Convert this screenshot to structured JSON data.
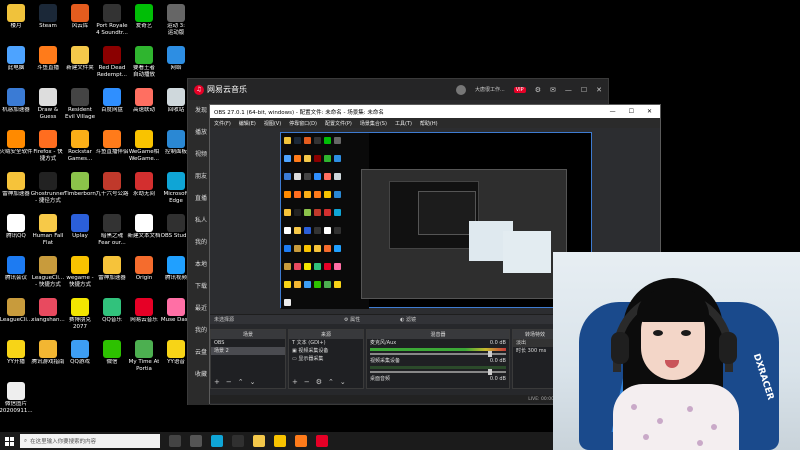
{
  "desktop_icons": [
    {
      "label": "楼月",
      "color": "#f0c23b"
    },
    {
      "label": "Steam",
      "color": "#1b2838"
    },
    {
      "label": "风云库",
      "color": "#e45c1e"
    },
    {
      "label": "Port Royale\n4 Soundtr...",
      "color": "#333"
    },
    {
      "label": "爱奇艺",
      "color": "#00be06"
    },
    {
      "label": "运动 3:\n运动版",
      "color": "#666"
    },
    {
      "label": "此电脑",
      "color": "#4da3ff"
    },
    {
      "label": "斗鱼直播",
      "color": "#ff7b1a"
    },
    {
      "label": "新建文件夹",
      "color": "#f4c84a"
    },
    {
      "label": "Red Dead\nRedempt...",
      "color": "#8b0000"
    },
    {
      "label": "要看王者\n自动播放",
      "color": "#2fb52f"
    },
    {
      "label": "网络",
      "color": "#2d8ee3"
    },
    {
      "label": "机惑加速器",
      "color": "#3a7bd5"
    },
    {
      "label": "Draw &\nGuess",
      "color": "#ddd"
    },
    {
      "label": "Resident\nEvil Village",
      "color": "#444"
    },
    {
      "label": "百度网盘",
      "color": "#2f8fff"
    },
    {
      "label": "高速联动",
      "color": "#ff6f61"
    },
    {
      "label": "回收站",
      "color": "#cfd8dc"
    },
    {
      "label": "火绒安全软件",
      "color": "#ff8a00"
    },
    {
      "label": "Firefox - 快\n捷方式",
      "color": "#ff6d1f"
    },
    {
      "label": "Rockstar\nGames...",
      "color": "#fcaf17"
    },
    {
      "label": "斗鱼直播伴侣",
      "color": "#ff7b1a"
    },
    {
      "label": "WeGame相\nWeGame...",
      "color": "#f9c300"
    },
    {
      "label": "控制面板",
      "color": "#2a88d4"
    },
    {
      "label": "雷神加速器",
      "color": "#f6c33a"
    },
    {
      "label": "Ghostrunner\n- 捷径方式",
      "color": "#222"
    },
    {
      "label": "Timberborn",
      "color": "#8bc34a"
    },
    {
      "label": "九十六号公路",
      "color": "#c0392b"
    },
    {
      "label": "永劫无间",
      "color": "#d32f2f"
    },
    {
      "label": "Microsoft\nEdge",
      "color": "#0fa5d6"
    },
    {
      "label": "腾讯QQ",
      "color": "#ffffff"
    },
    {
      "label": "Human Fall\nFlat",
      "color": "#f7c948"
    },
    {
      "label": "Uplay",
      "color": "#2b5fd9"
    },
    {
      "label": "暗黑之魂\nFear our...",
      "color": "#333"
    },
    {
      "label": "新建文本文档",
      "color": "#ffffff"
    },
    {
      "label": "OBS Studio",
      "color": "#303030"
    },
    {
      "label": "腾讯会议",
      "color": "#1d7bf2"
    },
    {
      "label": "LeagueCli...\n- 快捷方式",
      "color": "#c89b3c"
    },
    {
      "label": "wegame - \n快捷方式",
      "color": "#f9c300"
    },
    {
      "label": "雷神加速器",
      "color": "#f6c33a"
    },
    {
      "label": "Origin",
      "color": "#f56c2d"
    },
    {
      "label": "腾讯视频",
      "color": "#20a0ff"
    },
    {
      "label": "LeagueCli...",
      "color": "#c89b3c"
    },
    {
      "label": "xiangshan...",
      "color": "#e84a5f"
    },
    {
      "label": "赛博朋克\n2077",
      "color": "#f3e600"
    },
    {
      "label": "QQ音乐",
      "color": "#31c27c"
    },
    {
      "label": "网易云音乐",
      "color": "#e60026"
    },
    {
      "label": "Muse Dash",
      "color": "#ff6fa5"
    },
    {
      "label": "YY开播",
      "color": "#f7d417"
    },
    {
      "label": "腾讯游戏指南",
      "color": "#f2b632"
    },
    {
      "label": "QQ游戏",
      "color": "#3d9ef3"
    },
    {
      "label": "微信",
      "color": "#2dc100"
    },
    {
      "label": "My Time At\nPortia",
      "color": "#4caf50"
    },
    {
      "label": "YY语音",
      "color": "#f7d417"
    },
    {
      "label": "微信图片\n20200911...",
      "color": "#eeeeee"
    }
  ],
  "music": {
    "title": "网易云音乐",
    "user": "大唐很工作...",
    "vip": "VIP",
    "nav": [
      "发现",
      "播放",
      "视频",
      "朋友",
      "直播",
      "私人",
      "我的",
      "本地",
      "下载",
      "最近",
      "我的",
      "云盘",
      "收藏"
    ]
  },
  "obs": {
    "title": "OBS 27.0.1 (64-bit, windows) - 配置文件: 未命名 - 场景集: 未命名",
    "menu": [
      "文件(F)",
      "编辑(E)",
      "视图(V)",
      "停靠窗口(D)",
      "配置文件(P)",
      "场景集合(S)",
      "工具(T)",
      "帮助(H)"
    ],
    "dock_headers": [
      "场景",
      "来源",
      "混音器",
      "转场特效"
    ],
    "top_bar": "未选择源",
    "scene_items": [
      "OBS",
      "场景 2"
    ],
    "source_items": [
      "文本 (GDI+)",
      "视频采集设备",
      "显示器采集"
    ],
    "mixer_channels": [
      {
        "name": "麦克风/Aux",
        "db": "0.0 dB"
      },
      {
        "name": "视频采集设备",
        "db": "0.0 dB"
      },
      {
        "name": "桌面音频",
        "db": "0.0 dB"
      }
    ],
    "transition": "淡出",
    "duration_label": "时长",
    "duration_value": "300 ms",
    "status": [
      "LIVE: 00:00:00",
      "REC: 00:00:00",
      "CPU: 4.6%, 30.00 fps"
    ]
  },
  "webcam": {
    "chair_text": "DXRACER"
  },
  "taskbar": {
    "search_placeholder": "在这里输入你要搜索的内容",
    "icons": [
      {
        "name": "cortana-icon",
        "color": "#444"
      },
      {
        "name": "task-view-icon",
        "color": "#555"
      },
      {
        "name": "edge-icon",
        "color": "#0fa5d6"
      },
      {
        "name": "obs-icon",
        "color": "#303030"
      },
      {
        "name": "folder-icon",
        "color": "#f4c84a"
      },
      {
        "name": "wegame-icon",
        "color": "#f9c300"
      },
      {
        "name": "douyu-icon",
        "color": "#ff7b1a"
      },
      {
        "name": "cloudmusic-icon",
        "color": "#e60026"
      }
    ]
  }
}
